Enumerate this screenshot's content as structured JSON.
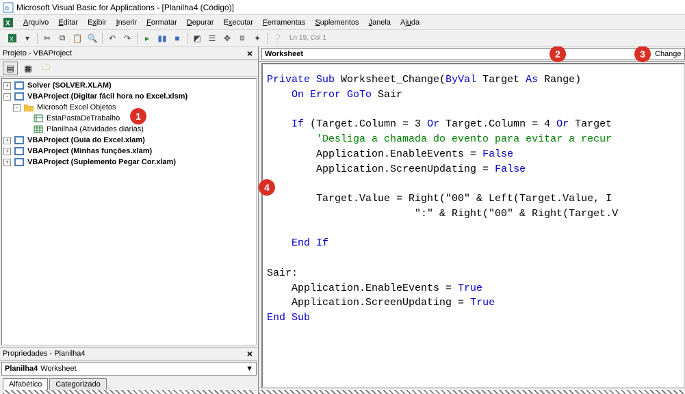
{
  "app": {
    "title": "Microsoft Visual Basic for Applications - [Planilha4 (Código)]"
  },
  "menubar": {
    "items": [
      {
        "label": "Arquivo",
        "u": "A"
      },
      {
        "label": "Editar",
        "u": "E"
      },
      {
        "label": "Exibir",
        "u": "x"
      },
      {
        "label": "Inserir",
        "u": "I"
      },
      {
        "label": "Formatar",
        "u": "F"
      },
      {
        "label": "Depurar",
        "u": "D"
      },
      {
        "label": "Executar",
        "u": "E"
      },
      {
        "label": "Ferramentas",
        "u": "F"
      },
      {
        "label": "Suplementos",
        "u": "S"
      },
      {
        "label": "Janela",
        "u": "J"
      },
      {
        "label": "Ajuda",
        "u": "A"
      }
    ]
  },
  "toolbar": {
    "status": "Ln 19, Col 1"
  },
  "project_explorer": {
    "title": "Projeto - VBAProject",
    "tree": [
      {
        "expander": "+",
        "icon": "vba",
        "label": "Solver (SOLVER.XLAM)",
        "bold": true,
        "indent": 0
      },
      {
        "expander": "-",
        "icon": "vba",
        "label": "VBAProject (Digitar fácil hora no Excel.xlsm)",
        "bold": true,
        "indent": 0
      },
      {
        "expander": "-",
        "icon": "folder",
        "label": "Microsoft Excel Objetos",
        "bold": false,
        "indent": 1
      },
      {
        "expander": "",
        "icon": "wb",
        "label": "EstaPastaDeTrabalho",
        "bold": false,
        "indent": 2
      },
      {
        "expander": "",
        "icon": "ws",
        "label": "Planilha4 (Atividades diárias)",
        "bold": false,
        "indent": 2
      },
      {
        "expander": "+",
        "icon": "vba",
        "label": "VBAProject (Guia do Excel.xlam)",
        "bold": true,
        "indent": 0
      },
      {
        "expander": "+",
        "icon": "vba",
        "label": "VBAProject (Minhas funções.xlam)",
        "bold": true,
        "indent": 0
      },
      {
        "expander": "+",
        "icon": "vba",
        "label": "VBAProject (Suplemento Pegar Cor.xlam)",
        "bold": true,
        "indent": 0
      }
    ]
  },
  "properties": {
    "title": "Propriedades - Planilha4",
    "object_name": "Planilha4",
    "object_type": "Worksheet",
    "tabs": [
      "Alfabético",
      "Categorizado"
    ]
  },
  "code_dropdowns": {
    "object": "Worksheet",
    "procedure": "Change"
  },
  "code_lines": [
    {
      "segments": [
        {
          "t": "Private Sub",
          "c": "kw"
        },
        {
          "t": " Worksheet_Change("
        },
        {
          "t": "ByVal",
          "c": "kw"
        },
        {
          "t": " Target "
        },
        {
          "t": "As",
          "c": "kw"
        },
        {
          "t": " Range)"
        }
      ]
    },
    {
      "segments": [
        {
          "t": "    "
        },
        {
          "t": "On Error GoTo",
          "c": "kw"
        },
        {
          "t": " Sair"
        }
      ]
    },
    {
      "segments": [
        {
          "t": ""
        }
      ]
    },
    {
      "segments": [
        {
          "t": "    "
        },
        {
          "t": "If",
          "c": "kw"
        },
        {
          "t": " (Target.Column = 3 "
        },
        {
          "t": "Or",
          "c": "kw"
        },
        {
          "t": " Target.Column = 4 "
        },
        {
          "t": "Or",
          "c": "kw"
        },
        {
          "t": " Target"
        }
      ]
    },
    {
      "segments": [
        {
          "t": "        "
        },
        {
          "t": "'Desliga a chamada do evento para evitar a recur",
          "c": "cmt"
        }
      ]
    },
    {
      "segments": [
        {
          "t": "        Application.EnableEvents = "
        },
        {
          "t": "False",
          "c": "kw"
        }
      ]
    },
    {
      "segments": [
        {
          "t": "        Application.ScreenUpdating = "
        },
        {
          "t": "False",
          "c": "kw"
        }
      ]
    },
    {
      "segments": [
        {
          "t": ""
        }
      ]
    },
    {
      "segments": [
        {
          "t": "        Target.Value = Right(\"00\" & Left(Target.Value, I"
        }
      ]
    },
    {
      "segments": [
        {
          "t": "                        \":\" & Right(\"00\" & Right(Target.V"
        }
      ]
    },
    {
      "segments": [
        {
          "t": ""
        }
      ]
    },
    {
      "segments": [
        {
          "t": "    "
        },
        {
          "t": "End If",
          "c": "kw"
        }
      ]
    },
    {
      "segments": [
        {
          "t": ""
        }
      ]
    },
    {
      "segments": [
        {
          "t": "Sair:"
        }
      ]
    },
    {
      "segments": [
        {
          "t": "    Application.EnableEvents = "
        },
        {
          "t": "True",
          "c": "kw"
        }
      ]
    },
    {
      "segments": [
        {
          "t": "    Application.ScreenUpdating = "
        },
        {
          "t": "True",
          "c": "kw"
        }
      ]
    },
    {
      "segments": [
        {
          "t": "End Sub",
          "c": "kw"
        }
      ]
    }
  ],
  "badges": {
    "b1": "1",
    "b2": "2",
    "b3": "3",
    "b4": "4"
  }
}
